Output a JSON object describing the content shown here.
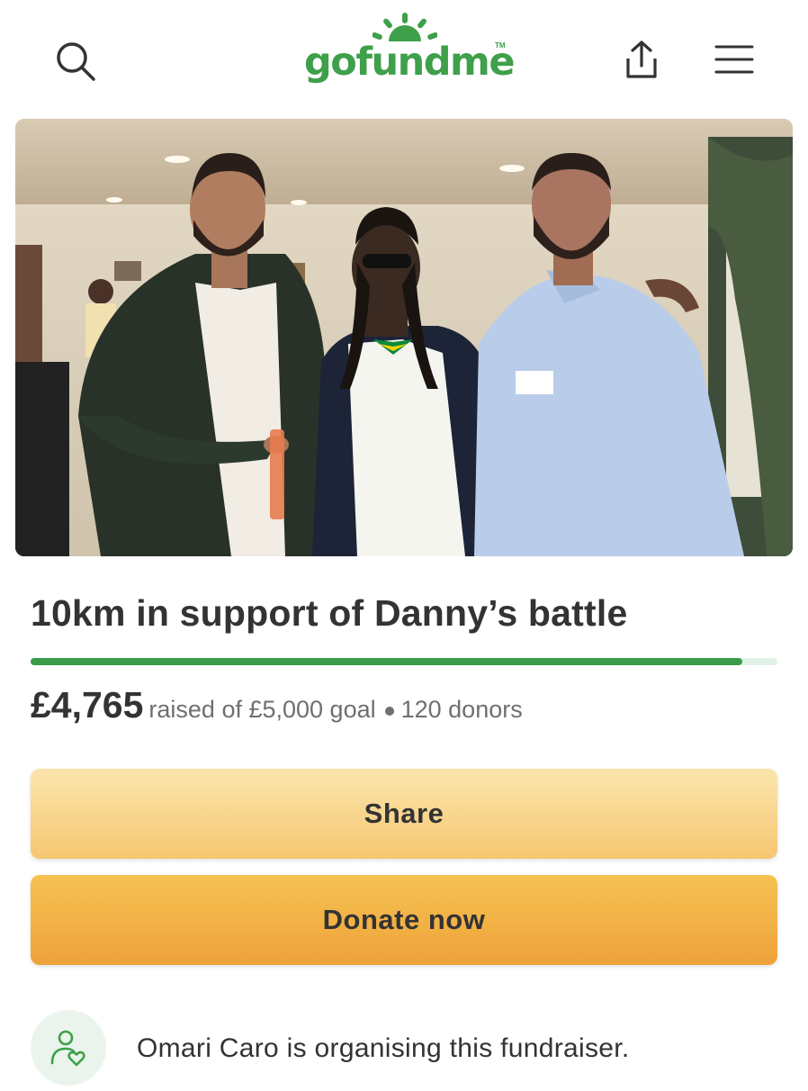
{
  "header": {
    "logo_text": "gofundme",
    "logo_tm": "TM",
    "brand_color": "#3ea04a",
    "icons": [
      "search-icon",
      "share-upload-icon",
      "hamburger-menu-icon"
    ]
  },
  "campaign": {
    "title": "10km in support of Danny’s battle",
    "raised": "£4,765",
    "raised_of_goal": "raised of £5,000 goal",
    "donors": "120 donors",
    "progress_fraction": 0.953
  },
  "buttons": {
    "share_label": "Share",
    "donate_label": "Donate now"
  },
  "organiser": {
    "text": "Omari Caro is organising this fundraiser."
  }
}
